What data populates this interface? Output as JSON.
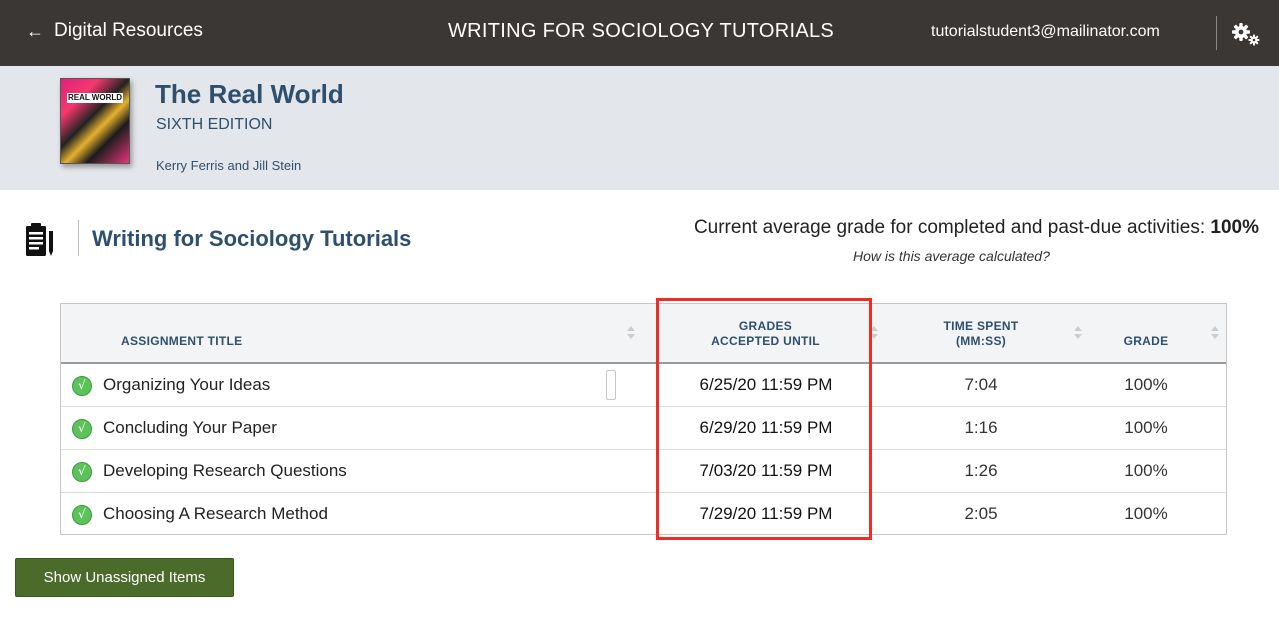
{
  "topbar": {
    "back_label": "Digital Resources",
    "title": "WRITING FOR SOCIOLOGY TUTORIALS",
    "user_email": "tutorialstudent3@mailinator.com",
    "settings_icon": "gears-icon"
  },
  "book": {
    "title": "The Real World",
    "edition": "SIXTH EDITION",
    "authors": "Kerry Ferris and Jill Stein",
    "cover_text": "REAL WORLD"
  },
  "section": {
    "icon": "clipboard-icon",
    "title": "Writing for Sociology Tutorials",
    "average_label": "Current average grade for completed and past-due activities: ",
    "average_value": "100%",
    "average_help": "How is this average calculated?"
  },
  "table": {
    "headers": {
      "title": "ASSIGNMENT TITLE",
      "grades_line1": "GRADES",
      "grades_line2": "ACCEPTED UNTIL",
      "time_line1": "TIME SPENT",
      "time_line2": "(MM:SS)",
      "grade": "GRADE"
    },
    "rows": [
      {
        "title": "Organizing Your Ideas",
        "accepted_until": "6/25/20 11:59 PM",
        "time": "7:04",
        "grade": "100%",
        "status": "completed"
      },
      {
        "title": "Concluding Your Paper",
        "accepted_until": "6/29/20 11:59 PM",
        "time": "1:16",
        "grade": "100%",
        "status": "completed"
      },
      {
        "title": "Developing Research Questions",
        "accepted_until": "7/03/20 11:59 PM",
        "time": "1:26",
        "grade": "100%",
        "status": "completed"
      },
      {
        "title": "Choosing A Research Method",
        "accepted_until": "7/29/20 11:59 PM",
        "time": "2:05",
        "grade": "100%",
        "status": "completed"
      }
    ]
  },
  "buttons": {
    "show_unassigned": "Show Unassigned Items"
  },
  "colors": {
    "topbar": "#3a3734",
    "bookbar": "#e3e6ea",
    "heading_blue": "#2f4f6e",
    "highlight_red": "#ee2e24",
    "button_green": "#4b6b2b",
    "check_green": "#5cc25a"
  }
}
